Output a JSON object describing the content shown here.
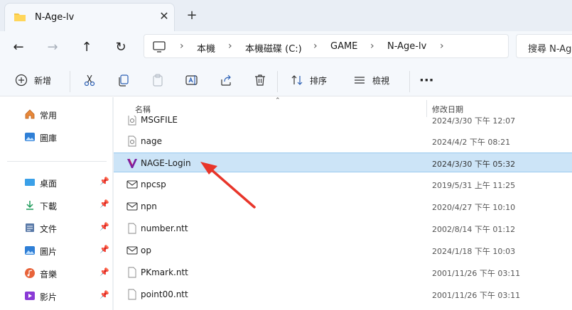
{
  "tab": {
    "title": "N-Age-lv",
    "close": "✕",
    "new_tab": "+"
  },
  "nav": {
    "back": "←",
    "forward": "→",
    "up": "↑",
    "refresh": "↻",
    "separator": "›",
    "breadcrumbs": [
      "本機",
      "本機磁碟 (C:)",
      "GAME",
      "N-Age-lv"
    ],
    "search_placeholder": "搜尋 N-Ag"
  },
  "toolbar": {
    "new_label": "新增",
    "sort_label": "排序",
    "view_label": "檢視",
    "more_label": "···"
  },
  "sidebar": {
    "pin": "📌",
    "top_items": [
      {
        "label": "常用",
        "icon": "home-icon"
      },
      {
        "label": "圖庫",
        "icon": "gallery-icon"
      }
    ],
    "pinned_items": [
      {
        "label": "桌面",
        "icon": "desktop-icon"
      },
      {
        "label": "下載",
        "icon": "download-icon"
      },
      {
        "label": "文件",
        "icon": "documents-icon"
      },
      {
        "label": "圖片",
        "icon": "pictures-icon"
      },
      {
        "label": "音樂",
        "icon": "music-icon"
      },
      {
        "label": "影片",
        "icon": "videos-icon"
      }
    ]
  },
  "list": {
    "col_name": "名稱",
    "col_date": "修改日期",
    "sort_indicator": "⌃",
    "rows": [
      {
        "name": "MSGFILE",
        "date": "2024/3/30 下午 12:07",
        "icon": "settings-file-icon",
        "selected": false
      },
      {
        "name": "nage",
        "date": "2024/4/2 下午 08:21",
        "icon": "settings-file-icon",
        "selected": false
      },
      {
        "name": "NAGE-Login",
        "date": "2024/3/30 下午 05:32",
        "icon": "nage-app-icon",
        "selected": true
      },
      {
        "name": "npcsp",
        "date": "2019/5/31 上午 11:25",
        "icon": "mail-file-icon",
        "selected": false
      },
      {
        "name": "npn",
        "date": "2020/4/27 下午 10:10",
        "icon": "mail-file-icon",
        "selected": false
      },
      {
        "name": "number.ntt",
        "date": "2002/8/14 下午 01:12",
        "icon": "blank-file-icon",
        "selected": false
      },
      {
        "name": "op",
        "date": "2024/1/18 下午 10:03",
        "icon": "mail-file-icon",
        "selected": false
      },
      {
        "name": "PKmark.ntt",
        "date": "2001/11/26 下午 03:11",
        "icon": "blank-file-icon",
        "selected": false
      },
      {
        "name": "point00.ntt",
        "date": "2001/11/26 下午 03:11",
        "icon": "blank-file-icon",
        "selected": false
      }
    ]
  },
  "colors": {
    "accent": "#0067c0",
    "selection": "#cce4f7",
    "annotation_arrow": "#e8352a",
    "app_icon": "#7a1fa2"
  }
}
